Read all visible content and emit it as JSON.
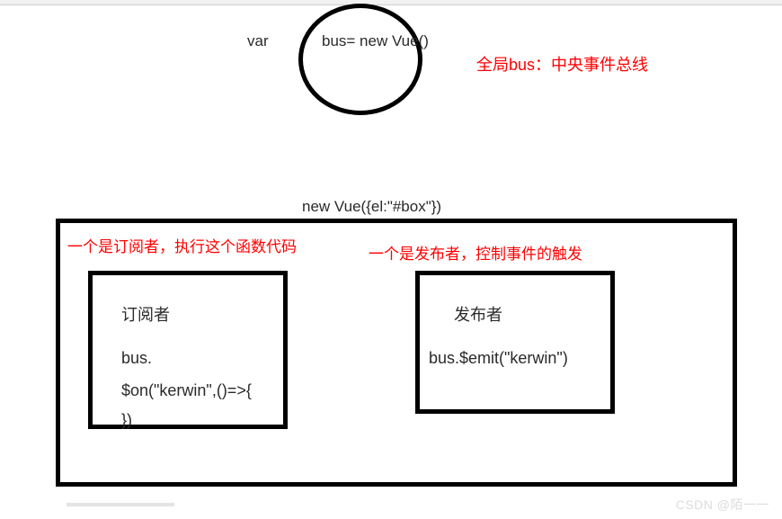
{
  "top": {
    "var_keyword": "var",
    "bus_code": "bus= new Vue()",
    "global_bus_note": "全局bus：中央事件总线"
  },
  "middle": {
    "new_vue_el": "new Vue({el:\"#box\"})"
  },
  "subscriber": {
    "note": "一个是订阅者，执行这个函数代码",
    "title": "订阅者",
    "code_line1": "bus.",
    "code_line2": "$on(\"kerwin\",()=>{",
    "code_line3": "})"
  },
  "publisher": {
    "note": "一个是发布者，控制事件的触发",
    "title": "发布者",
    "code": "bus.$emit(\"kerwin\")"
  },
  "watermark": "CSDN @陌一一"
}
